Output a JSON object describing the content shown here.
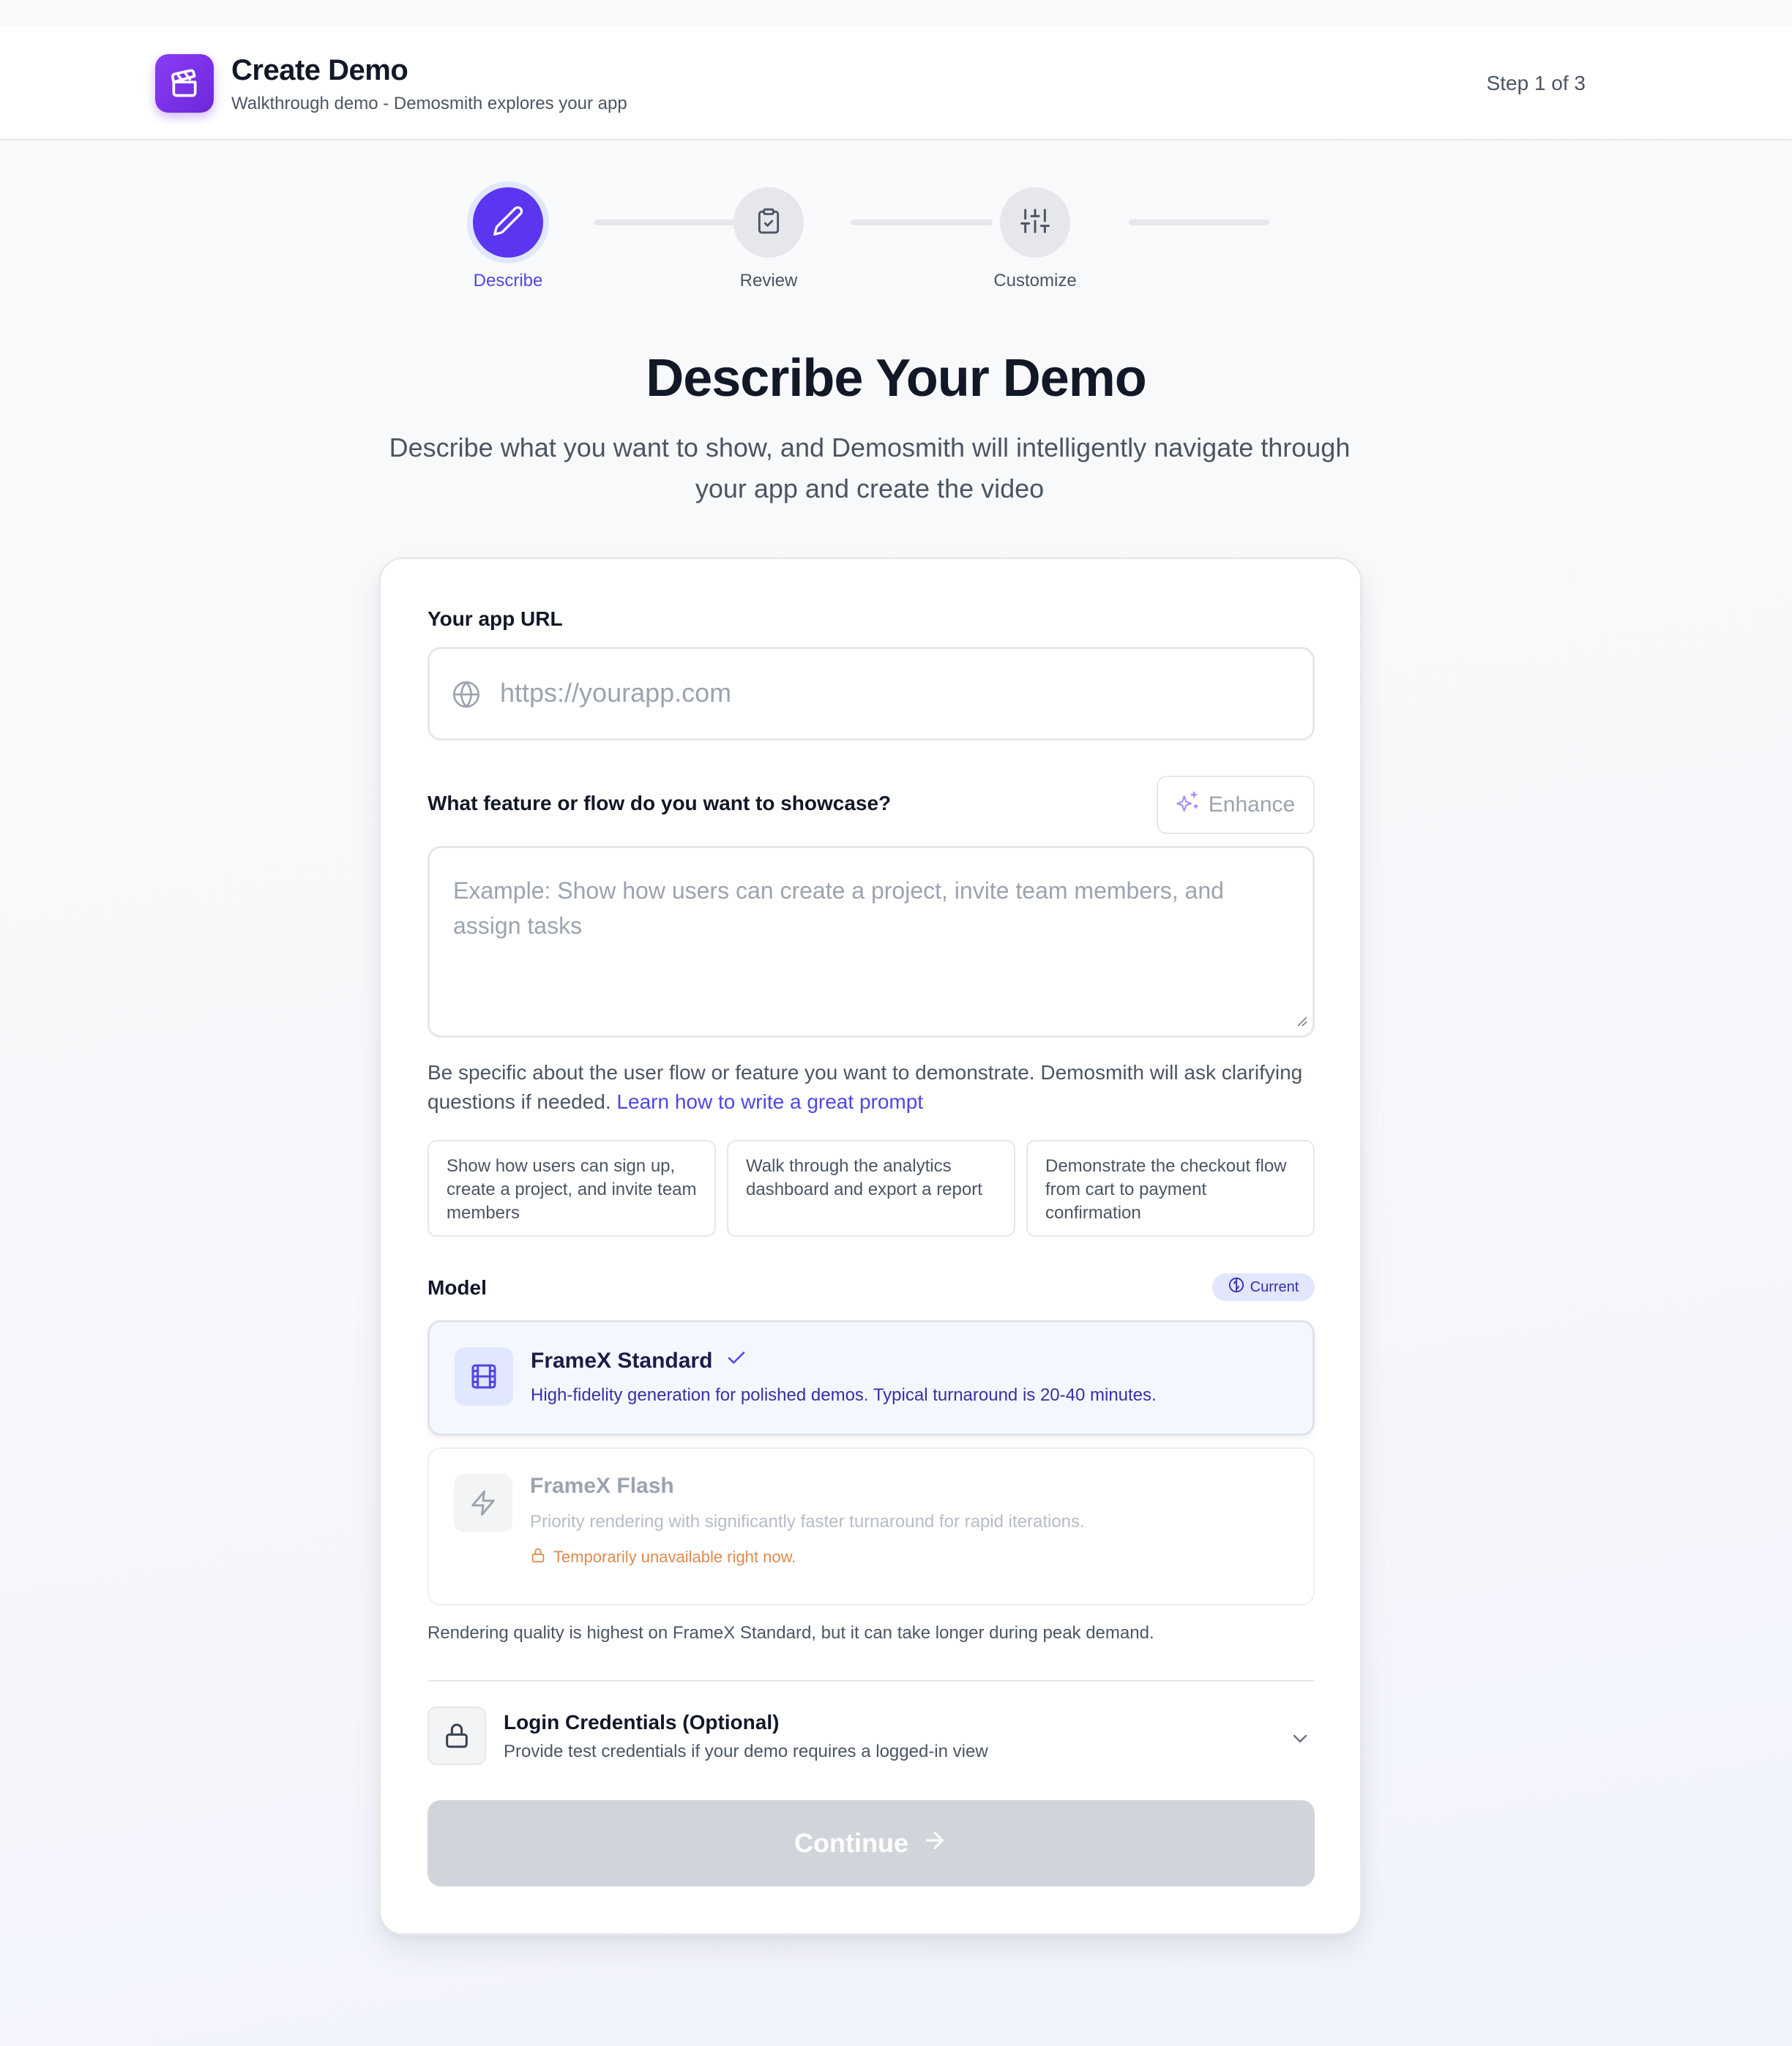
{
  "header": {
    "title": "Create Demo",
    "subtitle": "Walkthrough demo - Demosmith explores your app",
    "step_indicator": "Step 1 of 3"
  },
  "stepper": {
    "steps": [
      {
        "label": "Describe",
        "icon": "pencil-icon",
        "state": "active"
      },
      {
        "label": "Review",
        "icon": "clipboard-check-icon",
        "state": "idle"
      },
      {
        "label": "Customize",
        "icon": "sliders-icon",
        "state": "idle"
      }
    ]
  },
  "page": {
    "title": "Describe Your Demo",
    "subtitle": "Describe what you want to show, and Demosmith will intelligently navigate through your app and create the video"
  },
  "form": {
    "url_label": "Your app URL",
    "url_placeholder": "https://yourapp.com",
    "url_value": "",
    "feature_label": "What feature or flow do you want to showcase?",
    "enhance_label": "Enhance",
    "feature_placeholder": "Example: Show how users can create a project, invite team members, and assign tasks",
    "hint_text": "Be specific about the user flow or feature you want to demonstrate. Demosmith will ask clarifying questions if needed.",
    "hint_link": "Learn how to write a great prompt",
    "suggestions": [
      "Show how users can sign up, create a project, and invite team members",
      "Walk through the analytics dashboard and export a report",
      "Demonstrate the checkout flow from cart to payment confirmation"
    ]
  },
  "model": {
    "label": "Model",
    "badge": "Current",
    "options": [
      {
        "name": "FrameX Standard",
        "description": "High-fidelity generation for polished demos. Typical turnaround is 20-40 minutes.",
        "selected": true,
        "icon": "film-icon"
      },
      {
        "name": "FrameX Flash",
        "description": "Priority rendering with significantly faster turnaround for rapid iterations.",
        "warning": "Temporarily unavailable right now.",
        "selected": false,
        "icon": "lightning-icon"
      }
    ],
    "footnote": "Rendering quality is highest on FrameX Standard, but it can take longer during peak demand."
  },
  "credentials": {
    "title": "Login Credentials (Optional)",
    "subtitle": "Provide test credentials if your demo requires a logged-in view"
  },
  "actions": {
    "continue_label": "Continue"
  },
  "colors": {
    "accent": "#5b35ef",
    "link": "#4f46e5",
    "disabled_button": "#d1d5db",
    "warning": "#e08a4e"
  }
}
